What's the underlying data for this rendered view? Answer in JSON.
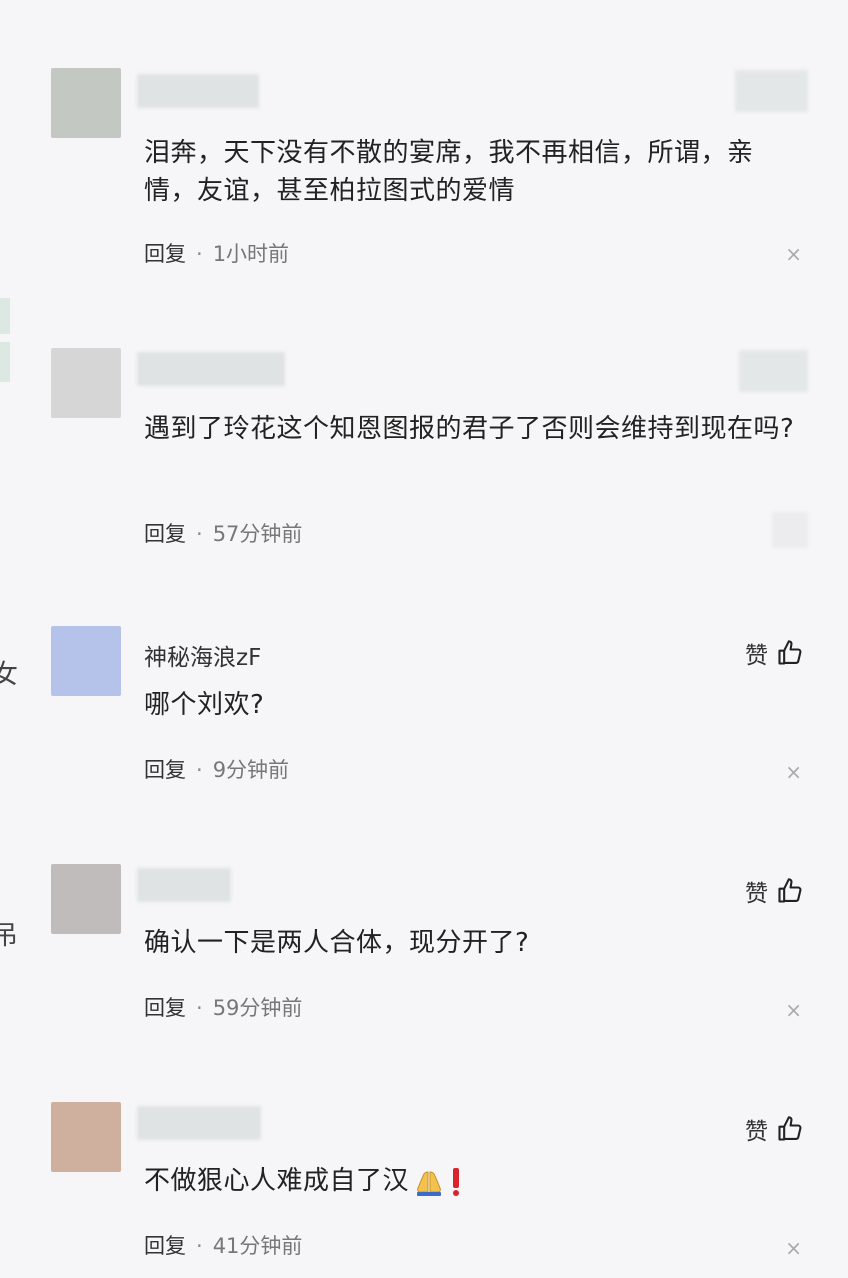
{
  "comments": [
    {
      "username": "",
      "text": "泪奔，天下没有不散的宴席，我不再相信，所谓，亲情，友谊，甚至柏拉图式的爱情",
      "reply_label": "回复",
      "time": "1小时前",
      "has_like": false,
      "avatar_color": "#c3c8c3"
    },
    {
      "username": "",
      "text": "遇到了玲花这个知恩图报的君子了否则会维持到现在吗?",
      "reply_label": "回复",
      "time": "57分钟前",
      "has_like": false,
      "avatar_color": "#d6d6d6"
    },
    {
      "username": "神秘海浪zF",
      "text": "哪个刘欢?",
      "reply_label": "回复",
      "time": "9分钟前",
      "has_like": true,
      "like_label": "赞",
      "avatar_color": "#b5c2ea"
    },
    {
      "username": "",
      "text": "确认一下是两人合体，现分开了?",
      "reply_label": "回复",
      "time": "59分钟前",
      "has_like": true,
      "like_label": "赞",
      "avatar_color": "#c0bcbb"
    },
    {
      "username": "",
      "text": "不做狠心人难成自了汉",
      "reply_label": "回复",
      "time": "41分钟前",
      "has_like": true,
      "like_label": "赞",
      "avatar_color": "#cfb09f",
      "trailing_emoji": [
        "folded-hands-emoji",
        "exclamation-emoji"
      ]
    }
  ],
  "close_symbol": "×",
  "separator_dot": "·"
}
